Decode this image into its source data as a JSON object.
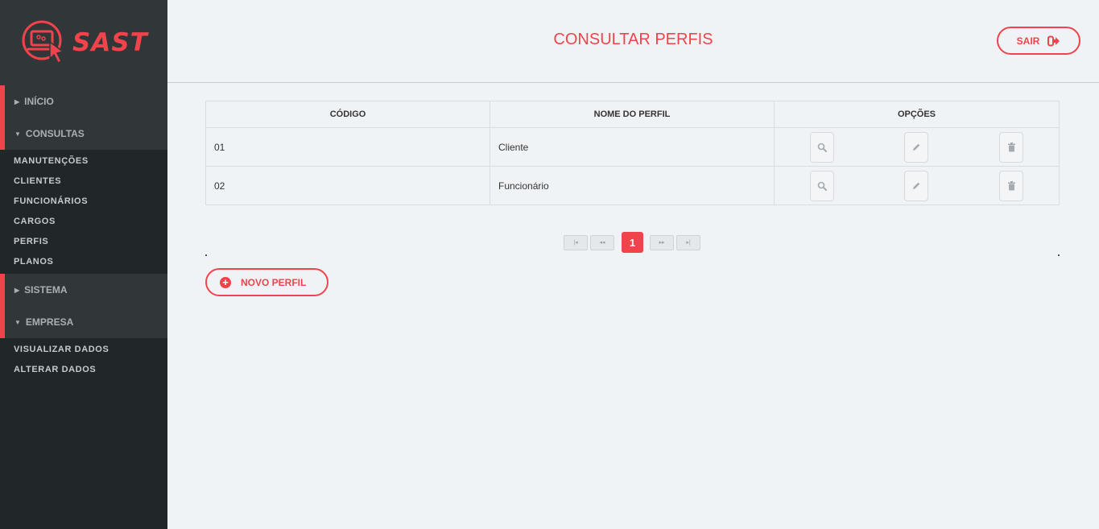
{
  "brand": {
    "name": "SAST"
  },
  "sidebar": {
    "sections": [
      {
        "label": "INÍCIO",
        "expanded": false,
        "items": []
      },
      {
        "label": "CONSULTAS",
        "expanded": true,
        "items": [
          "MANUTENÇÕES",
          "CLIENTES",
          "FUNCIONÁRIOS",
          "CARGOS",
          "PERFIS",
          "PLANOS"
        ]
      },
      {
        "label": "SISTEMA",
        "expanded": false,
        "items": []
      },
      {
        "label": "EMPRESA",
        "expanded": true,
        "items": [
          "VISUALIZAR DADOS",
          "ALTERAR DADOS"
        ]
      }
    ]
  },
  "header": {
    "title": "CONSULTAR PERFIS",
    "logout_label": "SAIR"
  },
  "table": {
    "columns": [
      "CÓDIGO",
      "NOME DO PERFIL",
      "OPÇÕES"
    ],
    "rows": [
      {
        "code": "01",
        "name": "Cliente"
      },
      {
        "code": "02",
        "name": "Funcionário"
      }
    ]
  },
  "pagination": {
    "first": "|◂",
    "prev": "◂◂",
    "current": "1",
    "next": "▸▸",
    "last": "▸|"
  },
  "actions": {
    "new_label": "NOVO PERFIL"
  },
  "colors": {
    "accent": "#f0434b",
    "sidebar_bg": "#212629",
    "sidebar_section_bg": "#313639",
    "content_bg": "#f0f3f6"
  }
}
